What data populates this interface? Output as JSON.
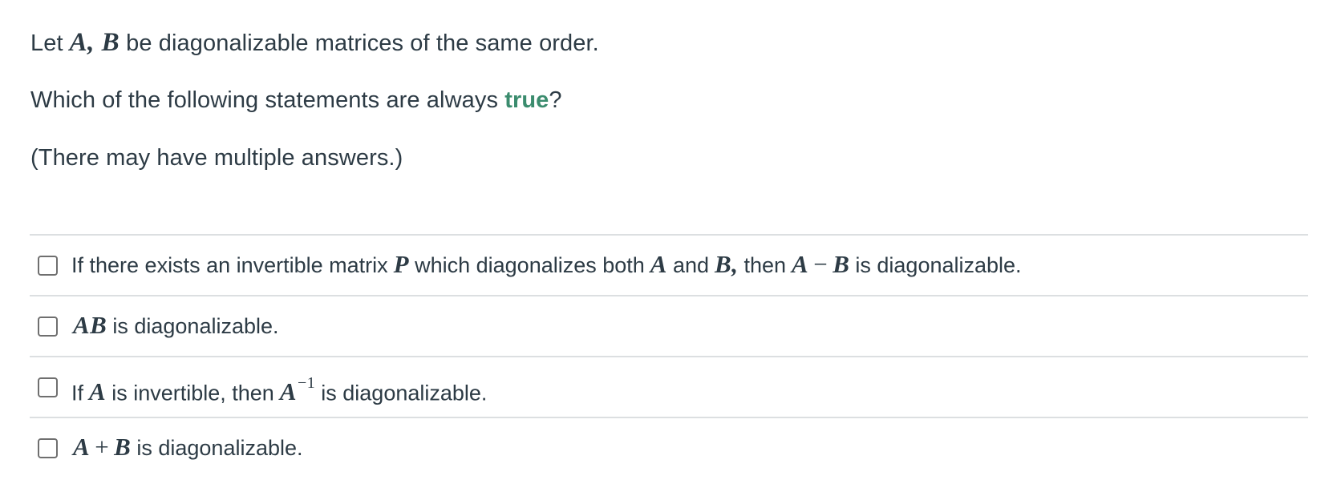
{
  "question": {
    "line1": {
      "prefix": "Let",
      "math": "A, B",
      "suffix": "be diagonalizable matrices of the same order."
    },
    "line2": {
      "prefix": "Which of the following statements are always",
      "highlight": "true",
      "suffix": "?"
    },
    "line3": "(There may have multiple answers.)",
    "accent_color": "#3b8c6e"
  },
  "options": [
    {
      "checked": false,
      "parts": {
        "t1": "If there exists an invertible matrix",
        "m1": "P",
        "t2": "which diagonalizes both",
        "m2": "A",
        "t3": "and",
        "m3": "B,",
        "t4": "then",
        "m4a": "A",
        "m4op": "−",
        "m4b": "B",
        "t5": "is diagonalizable."
      }
    },
    {
      "checked": false,
      "parts": {
        "m1": "AB",
        "t1": "is diagonalizable."
      }
    },
    {
      "checked": false,
      "parts": {
        "t1": "If",
        "m1": "A",
        "t2": "is invertible, then",
        "m2": "A",
        "m2sup": "−1",
        "t3": "is diagonalizable."
      }
    },
    {
      "checked": false,
      "parts": {
        "m1a": "A",
        "m1op": "+",
        "m1b": "B",
        "t1": "is diagonalizable."
      }
    }
  ]
}
